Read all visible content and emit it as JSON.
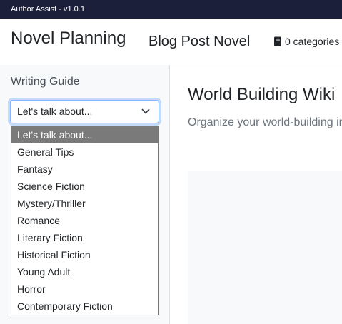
{
  "app": {
    "title": "Author Assist - v1.0.1"
  },
  "header": {
    "brand": "Novel Planning",
    "project": "Blog Post Novel",
    "categories": "0 categories",
    "categories_icon": "book-icon"
  },
  "sidebar": {
    "title": "Writing Guide",
    "select": {
      "value": "Let's talk about...",
      "options": [
        "Let's talk about...",
        "General Tips",
        "Fantasy",
        "Science Fiction",
        "Mystery/Thriller",
        "Romance",
        "Literary Fiction",
        "Historical Fiction",
        "Young Adult",
        "Horror",
        "Contemporary Fiction"
      ]
    }
  },
  "main": {
    "title": "World Building Wiki",
    "subtitle": "Organize your world-building information"
  },
  "colors": {
    "titlebar": "#1c1f3a",
    "selected_option": "#7a7a7a",
    "focus_ring": "#86b7fe"
  }
}
